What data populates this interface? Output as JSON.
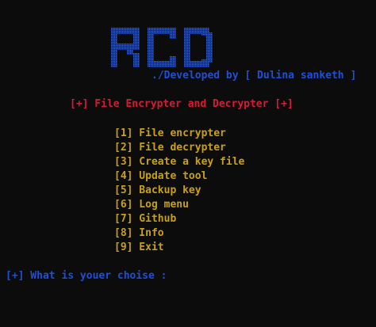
{
  "banner": {
    "logo_text": "RCD",
    "logo_color": "#1f4fd6",
    "developer_line": "./Developed by [ Dulina sanketh ]",
    "developer_color": "#1f4fd6"
  },
  "app": {
    "title": "[+] File Encrypter and Decrypter [+]",
    "title_color": "#d51b34"
  },
  "menu": {
    "color": "#c8a018",
    "items": [
      {
        "label": "[1] File encrypter"
      },
      {
        "label": "[2] File decrypter"
      },
      {
        "label": "[3] Create a key file"
      },
      {
        "label": "[4] Update tool"
      },
      {
        "label": "[5] Backup key"
      },
      {
        "label": "[6] Log menu"
      },
      {
        "label": "[7] Github"
      },
      {
        "label": "[8] Info"
      },
      {
        "label": "[9] Exit"
      }
    ]
  },
  "prompt": {
    "text": "[+] What is youer choise : ",
    "color": "#1f4fd6"
  },
  "background_color": "#0c0c0c"
}
